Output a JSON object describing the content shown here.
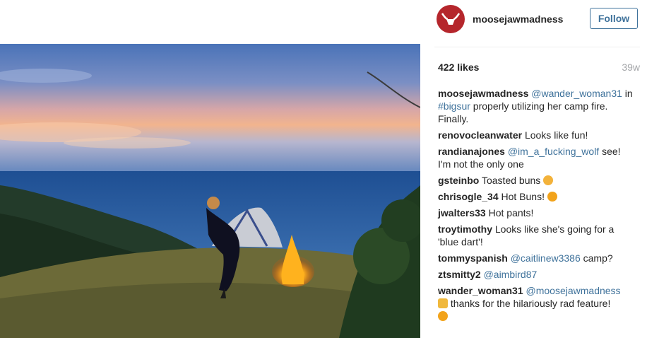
{
  "header": {
    "username": "moosejawmadness",
    "follow_label": "Follow"
  },
  "stats": {
    "likes": "422 likes",
    "age": "39w"
  },
  "comments": [
    {
      "user": "moosejawmadness",
      "mention": "@wander_woman31",
      "text1": " in ",
      "hashtag": "#bigsur",
      "text2": " properly utilizing her camp fire. Finally."
    },
    {
      "user": "renovocleanwater",
      "text": " Looks like fun!"
    },
    {
      "user": "randianajones",
      "mention": "@im_a_fucking_wolf",
      "text": " see! I'm not the only one"
    },
    {
      "user": "gsteinbo",
      "text": " Toasted buns",
      "emoji": "ok-hand-emoji"
    },
    {
      "user": "chrisogle_34",
      "text": " Hot Buns!",
      "emoji": "grinning-emoji"
    },
    {
      "user": "jwalters33",
      "text": " Hot pants!"
    },
    {
      "user": "troytimothy",
      "text": " Looks like she's going for a 'blue dart'!"
    },
    {
      "user": "tommyspanish",
      "mention": "@caitlinew3386",
      "text": " camp?"
    },
    {
      "user": "ztsmitty2",
      "mention": "@aimbird87"
    },
    {
      "user": "wander_woman31",
      "mention": "@moosejawmadness",
      "text": " thanks for the hilariously rad feature!",
      "emoji1": "raised-hands-emoji",
      "emoji2": "laughing-emoji"
    }
  ],
  "colors": {
    "link": "#3f729b",
    "brand": "#b5262c",
    "muted": "#a5a7aa"
  }
}
